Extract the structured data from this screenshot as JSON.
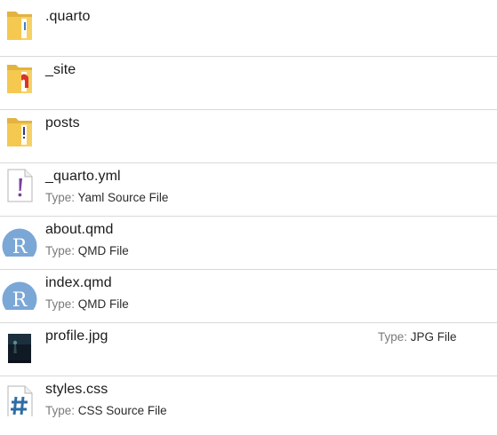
{
  "colors": {
    "folder_yellow": "#f7d166",
    "folder_dark": "#e2b43f",
    "r_icon_blue": "#7aa7d6",
    "css_hash_blue": "#2f6da3",
    "yaml_purple": "#7a3fa0",
    "divider": "#d9d9d9"
  },
  "items": [
    {
      "name": ".quarto",
      "icon": "folder-icon"
    },
    {
      "name": "_site",
      "icon": "folder-icon"
    },
    {
      "name": "posts",
      "icon": "folder-icon"
    },
    {
      "name": "_quarto.yml",
      "icon": "yaml-file-icon",
      "type_label": "Type:",
      "type_value": "Yaml Source File"
    },
    {
      "name": "about.qmd",
      "icon": "r-file-icon",
      "type_label": "Type:",
      "type_value": "QMD File"
    },
    {
      "name": "index.qmd",
      "icon": "r-file-icon",
      "type_label": "Type:",
      "type_value": "QMD File"
    },
    {
      "name": "profile.jpg",
      "icon": "image-thumbnail-icon",
      "type_label": "Type:",
      "type_value": "JPG File"
    },
    {
      "name": "styles.css",
      "icon": "css-file-icon",
      "type_label": "Type:",
      "type_value": "CSS Source File"
    }
  ]
}
